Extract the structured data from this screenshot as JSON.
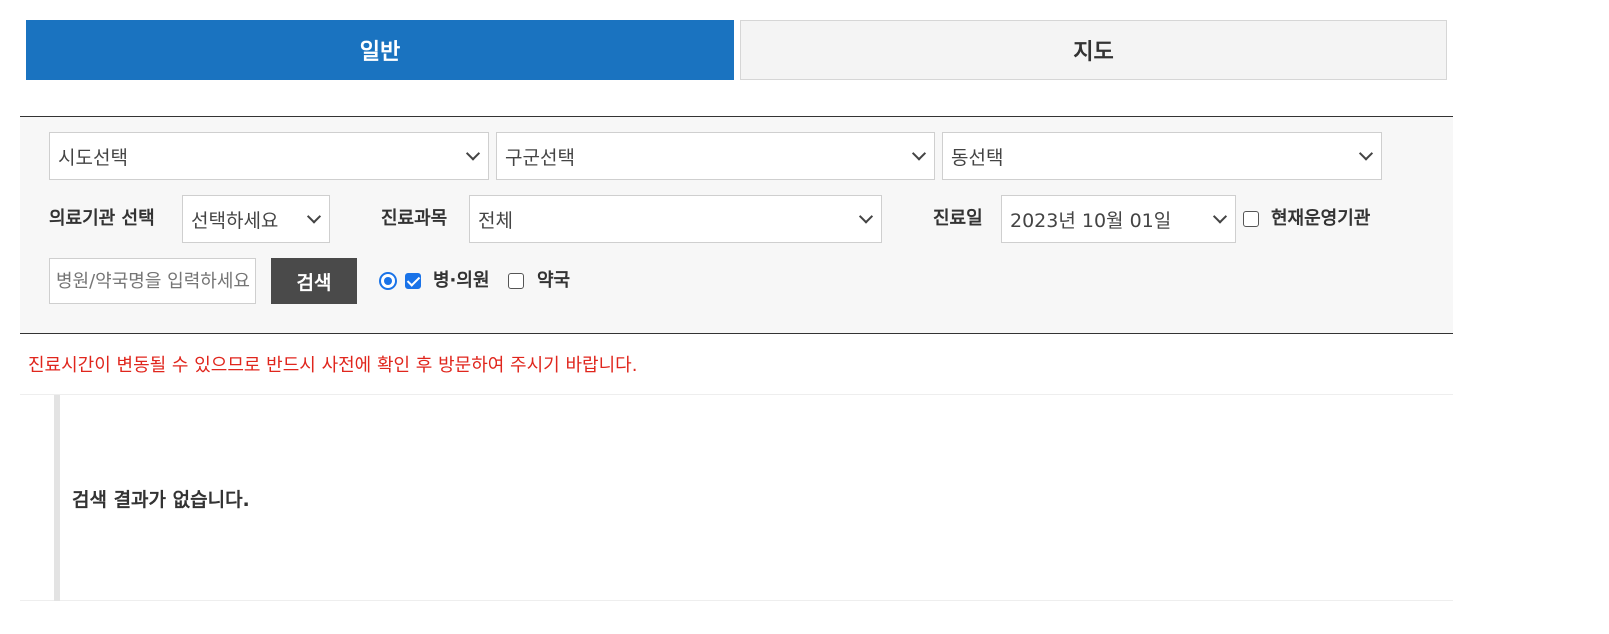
{
  "tabs": {
    "general": "일반",
    "map": "지도"
  },
  "filters": {
    "sido": "시도선택",
    "gugun": "구군선택",
    "dong": "동선택",
    "institution_label": "의료기관 선택",
    "institution_value": "선택하세요",
    "department_label": "진료과목",
    "department_value": "전체",
    "date_label": "진료일",
    "date_value": "2023년 10월 01일",
    "open_now_label": "현재운영기관",
    "open_now_checked": false
  },
  "search": {
    "placeholder": "병원/약국명을 입력하세요",
    "button": "검색"
  },
  "type_options": {
    "hospital_label": "병·의원",
    "hospital_checked": true,
    "pharmacy_label": "약국",
    "pharmacy_checked": false
  },
  "notice": "진료시간이 변동될 수 있으므로 반드시 사전에 확인 후 방문하여 주시기 바랍니다.",
  "results": {
    "empty_message": "검색 결과가 없습니다."
  },
  "colors": {
    "accent": "#1a73c0",
    "notice": "#e0261d",
    "button": "#4a4a4a"
  }
}
